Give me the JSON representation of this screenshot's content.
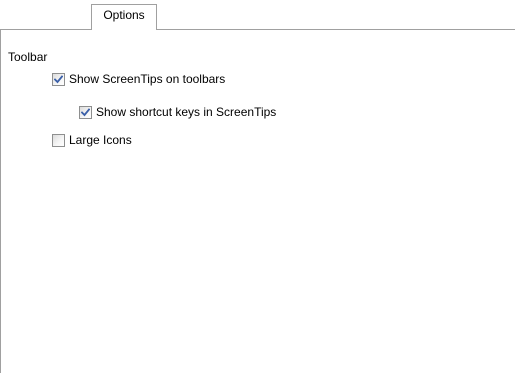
{
  "tabs": [
    {
      "label": "Options",
      "active": true
    }
  ],
  "options_panel": {
    "group_label": "Toolbar",
    "options": [
      {
        "label": "Show ScreenTips on toolbars",
        "checked": true
      },
      {
        "label": "Show shortcut keys in ScreenTips",
        "checked": true
      },
      {
        "label": "Large Icons",
        "checked": false
      }
    ]
  },
  "colors": {
    "border": "#a0a0a0",
    "checkmark": "#3a5fa8",
    "background": "#ffffff"
  }
}
